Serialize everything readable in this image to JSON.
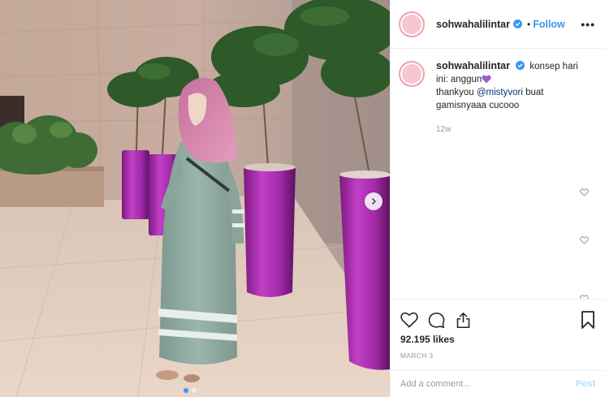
{
  "post": {
    "username": "sohwahalilintar",
    "follow_label": "Follow",
    "separator": "•",
    "more_label": "•••",
    "colors": {
      "accent": "#3897f0",
      "verified": "#3897f0",
      "post_disabled": "#b2dffc"
    }
  },
  "caption": {
    "username": "sohwahalilintar",
    "line1": "konsep hari ini: anggun",
    "line2_prefix": "thankyou ",
    "mention": "@mistyvori",
    "line2_suffix": " buat gamisnyaaa cucooo",
    "time_ago": "12w"
  },
  "carousel": {
    "slide_count": 2,
    "active_slide": 1
  },
  "actions": {
    "like_icon": "heart-outline-icon",
    "comment_icon": "comment-bubble-icon",
    "share_icon": "share-icon",
    "save_icon": "bookmark-icon",
    "likes_text": "92.195 likes",
    "date": "MARCH 3"
  },
  "comment_box": {
    "placeholder": "Add a comment...",
    "post_label": "Post"
  }
}
